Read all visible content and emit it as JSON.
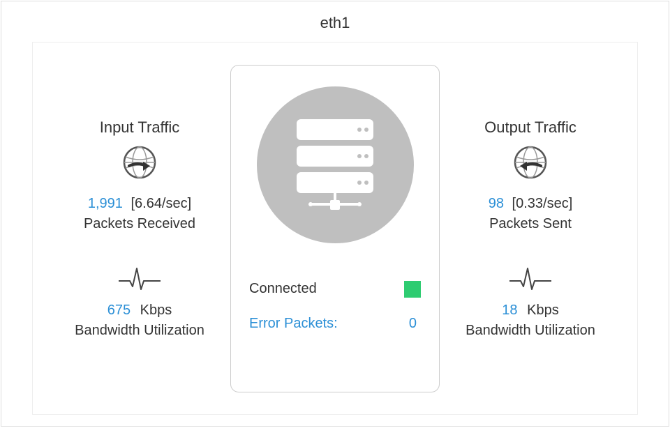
{
  "title": "eth1",
  "input": {
    "heading": "Input Traffic",
    "packets_count": "1,991",
    "packets_rate": "[6.64/sec]",
    "packets_label": "Packets Received",
    "bandwidth_value": "675",
    "bandwidth_unit": "Kbps",
    "bandwidth_label": "Bandwidth Utilization"
  },
  "output": {
    "heading": "Output Traffic",
    "packets_count": "98",
    "packets_rate": "[0.33/sec]",
    "packets_label": "Packets Sent",
    "bandwidth_value": "18",
    "bandwidth_unit": "Kbps",
    "bandwidth_label": "Bandwidth Utilization"
  },
  "center": {
    "status_label": "Connected",
    "error_label": "Error Packets:",
    "error_value": "0",
    "status_color": "#2ecc71"
  }
}
